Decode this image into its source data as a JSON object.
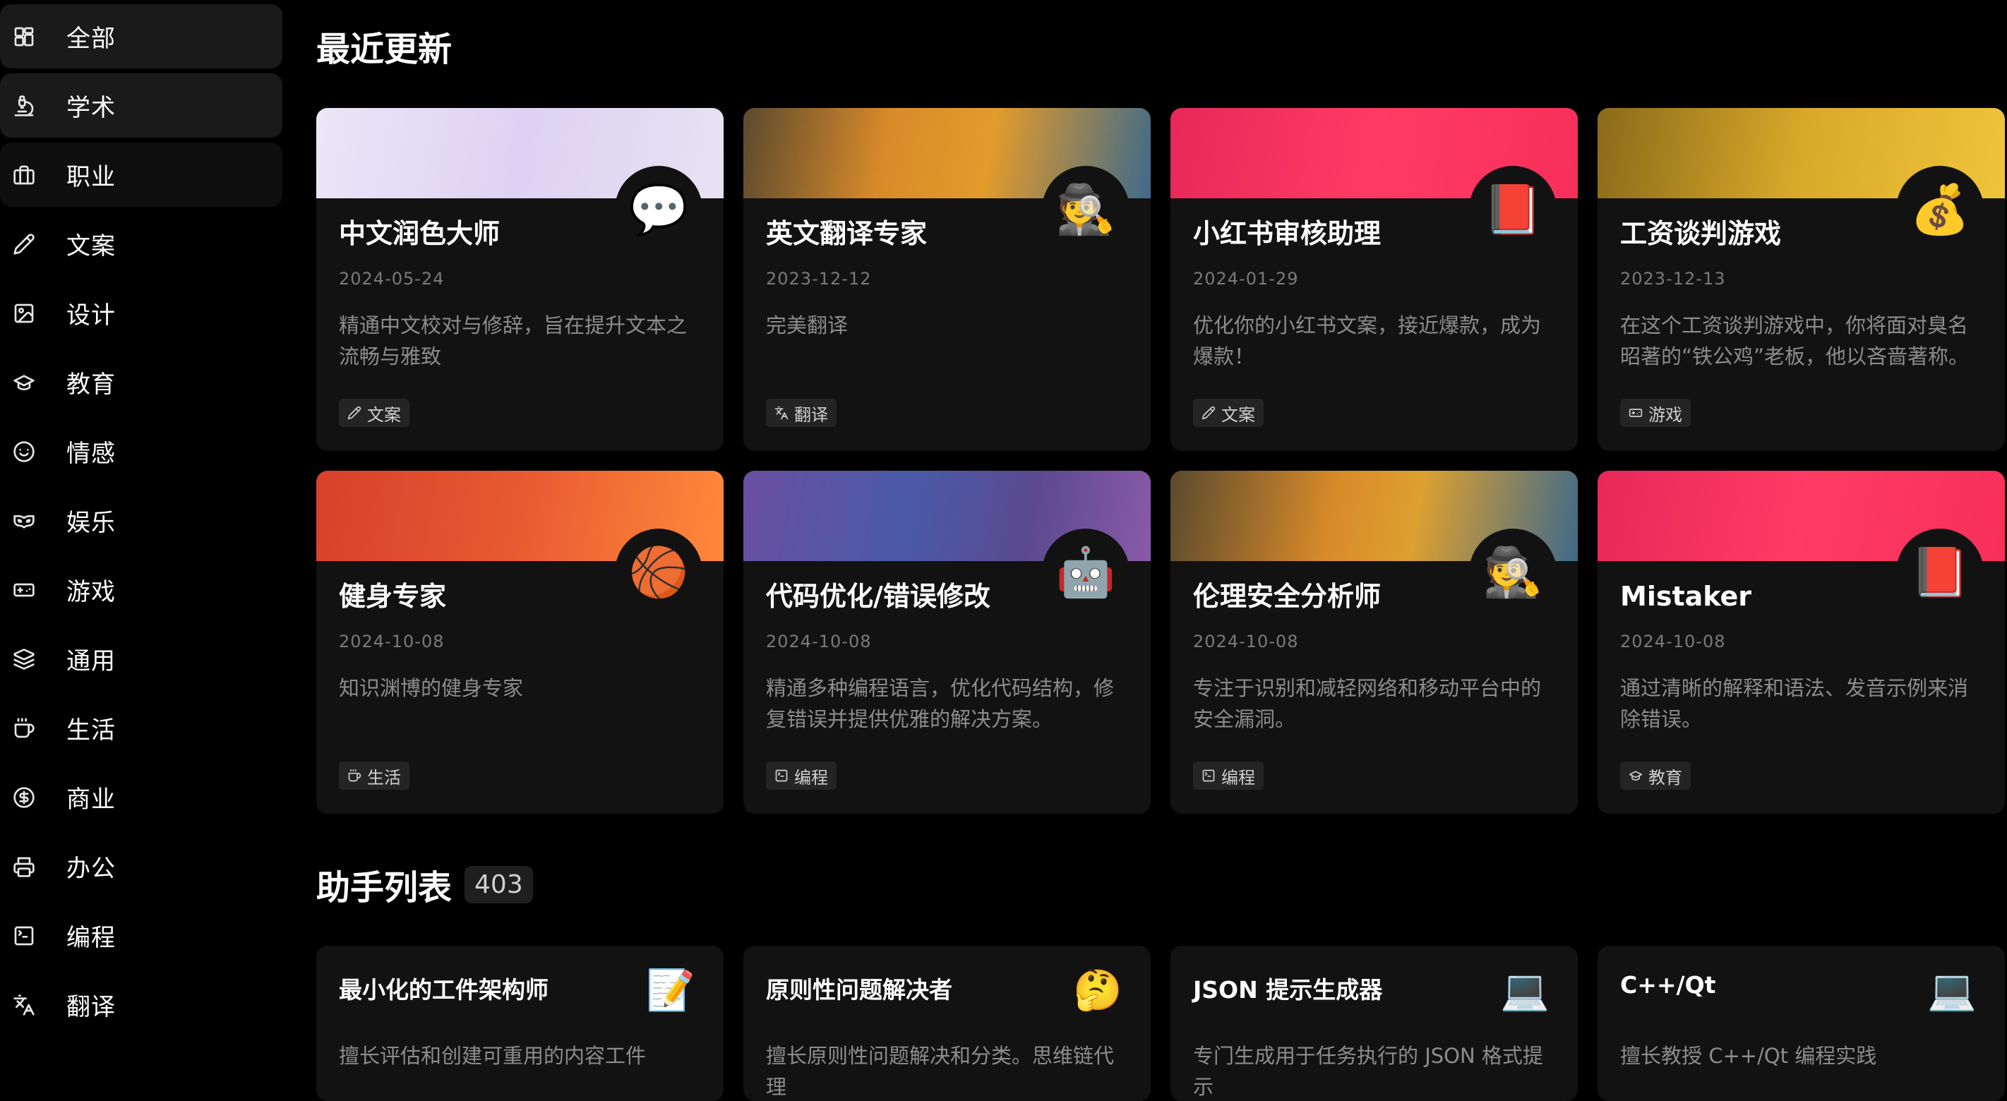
{
  "sidebar": {
    "items": [
      {
        "label": "全部",
        "icon": "grid-icon"
      },
      {
        "label": "学术",
        "icon": "microscope-icon"
      },
      {
        "label": "职业",
        "icon": "briefcase-icon"
      },
      {
        "label": "文案",
        "icon": "pencil-icon"
      },
      {
        "label": "设计",
        "icon": "image-icon"
      },
      {
        "label": "教育",
        "icon": "graduation-cap-icon"
      },
      {
        "label": "情感",
        "icon": "smile-icon"
      },
      {
        "label": "娱乐",
        "icon": "drama-mask-icon"
      },
      {
        "label": "游戏",
        "icon": "gamepad-icon"
      },
      {
        "label": "通用",
        "icon": "layers-icon"
      },
      {
        "label": "生活",
        "icon": "coffee-cup-icon"
      },
      {
        "label": "商业",
        "icon": "dollar-circle-icon"
      },
      {
        "label": "办公",
        "icon": "printer-icon"
      },
      {
        "label": "编程",
        "icon": "terminal-icon"
      },
      {
        "label": "翻译",
        "icon": "languages-icon"
      }
    ]
  },
  "recent": {
    "title": "最近更新",
    "cards": [
      {
        "title": "中文润色大师",
        "date": "2024-05-24",
        "desc": "精通中文校对与修辞，旨在提升文本之流畅与雅致",
        "tag": "文案",
        "tag_icon": "pencil-icon",
        "emoji": "💬",
        "avatar_icon": "speech-bubble-icon",
        "banner": "linear-gradient(100deg,#ece6f7 0%,#ddd2f3 50%,#e7e2f2 100%)"
      },
      {
        "title": "英文翻译专家",
        "date": "2023-12-12",
        "desc": "完美翻译",
        "tag": "翻译",
        "tag_icon": "languages-icon",
        "emoji": "🕵️",
        "avatar_icon": "detective-icon",
        "banner": "linear-gradient(100deg,#5b4a2e 0%,#d98a2a 35%,#e39b2b 60%,#3f6a8a 100%)"
      },
      {
        "title": "小红书审核助理",
        "date": "2024-01-29",
        "desc": "优化你的小红书文案，接近爆款，成为爆款！",
        "tag": "文案",
        "tag_icon": "pencil-icon",
        "emoji": "📕",
        "avatar_icon": "red-book-icon",
        "banner": "linear-gradient(100deg,#e8285a 0%,#ff3b64 50%,#f72f5a 100%)"
      },
      {
        "title": "工资谈判游戏",
        "date": "2023-12-13",
        "desc": "在这个工资谈判游戏中，你将面对臭名昭著的“铁公鸡”老板，他以吝啬著称。作…",
        "tag": "游戏",
        "tag_icon": "gamepad-icon",
        "emoji": "💰",
        "avatar_icon": "money-bag-icon",
        "banner": "linear-gradient(100deg,#8a6a1a 0%,#d9a92a 50%,#f0c43a 100%)"
      },
      {
        "title": "健身专家",
        "date": "2024-10-08",
        "desc": "知识渊博的健身专家",
        "tag": "生活",
        "tag_icon": "coffee-cup-icon",
        "emoji": "🏀",
        "avatar_icon": "basketball-icon",
        "banner": "linear-gradient(100deg,#d8402a 0%,#e85a32 50%,#ff8a3a 100%)"
      },
      {
        "title": "代码优化/错误修改",
        "date": "2024-10-08",
        "desc": "精通多种编程语言，优化代码结构，修复错误并提供优雅的解决方案。",
        "tag": "编程",
        "tag_icon": "terminal-icon",
        "emoji": "🤖",
        "avatar_icon": "robot-icon",
        "banner": "linear-gradient(100deg,#6a4fa0 0%,#4a5aa8 40%,#5b4a90 70%,#8a5aa8 100%)"
      },
      {
        "title": "伦理安全分析师",
        "date": "2024-10-08",
        "desc": "专注于识别和减轻网络和移动平台中的安全漏洞。",
        "tag": "编程",
        "tag_icon": "terminal-icon",
        "emoji": "🕵️",
        "avatar_icon": "detective-icon",
        "banner": "linear-gradient(100deg,#5a4a2e 0%,#d98a2a 40%,#dca030 60%,#3f6a8a 100%)"
      },
      {
        "title": "Mistaker",
        "date": "2024-10-08",
        "desc": "通过清晰的解释和语法、发音示例来消除错误。",
        "tag": "教育",
        "tag_icon": "graduation-cap-icon",
        "emoji": "📕",
        "avatar_icon": "red-book-icon",
        "banner": "linear-gradient(100deg,#e8285a 0%,#ff3b64 50%,#f72f5a 100%)"
      }
    ]
  },
  "assistants": {
    "title": "助手列表",
    "count": "403",
    "cards": [
      {
        "title": "最小化的工件架构师",
        "desc": "擅长评估和创建可重用的内容工件",
        "emoji": "📝",
        "icon": "memo-icon"
      },
      {
        "title": "原则性问题解决者",
        "desc": "擅长原则性问题解决和分类。思维链代理",
        "emoji": "🤔",
        "icon": "thinking-face-icon"
      },
      {
        "title": "JSON 提示生成器",
        "desc": "专门生成用于任务执行的 JSON 格式提示",
        "emoji": "💻",
        "icon": "laptop-icon"
      },
      {
        "title": "C++/Qt",
        "desc": "擅长教授 C++/Qt 编程实践",
        "emoji": "💻",
        "icon": "laptop-icon"
      }
    ]
  }
}
